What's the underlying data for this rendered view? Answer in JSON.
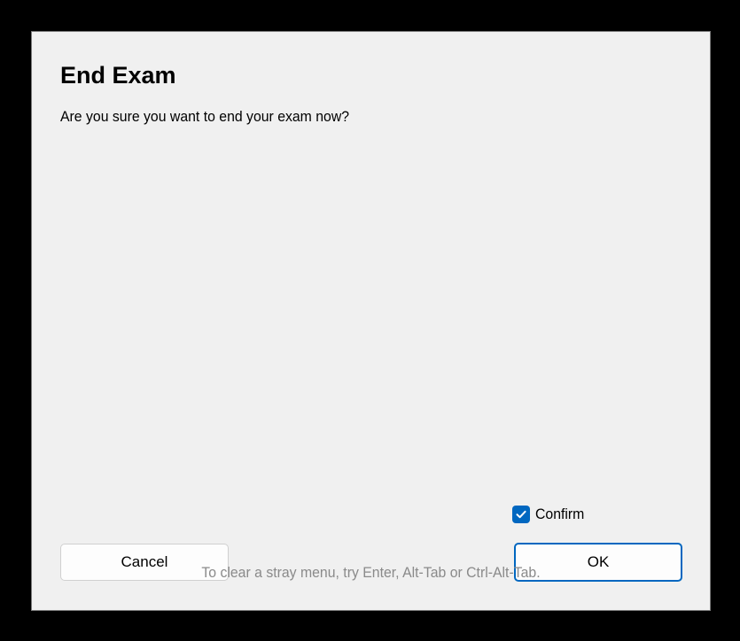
{
  "dialog": {
    "title": "End Exam",
    "message": "Are you sure you want to end your exam now?",
    "confirm": {
      "label": "Confirm",
      "checked": true
    },
    "buttons": {
      "cancel_label": "Cancel",
      "ok_label": "OK"
    },
    "hint": "To clear a stray menu, try Enter, Alt-Tab or Ctrl-Alt-Tab."
  },
  "colors": {
    "accent": "#0067c0",
    "background": "#f0f0f0",
    "backdrop": "#000000",
    "hint_text": "#8a8a8a"
  }
}
